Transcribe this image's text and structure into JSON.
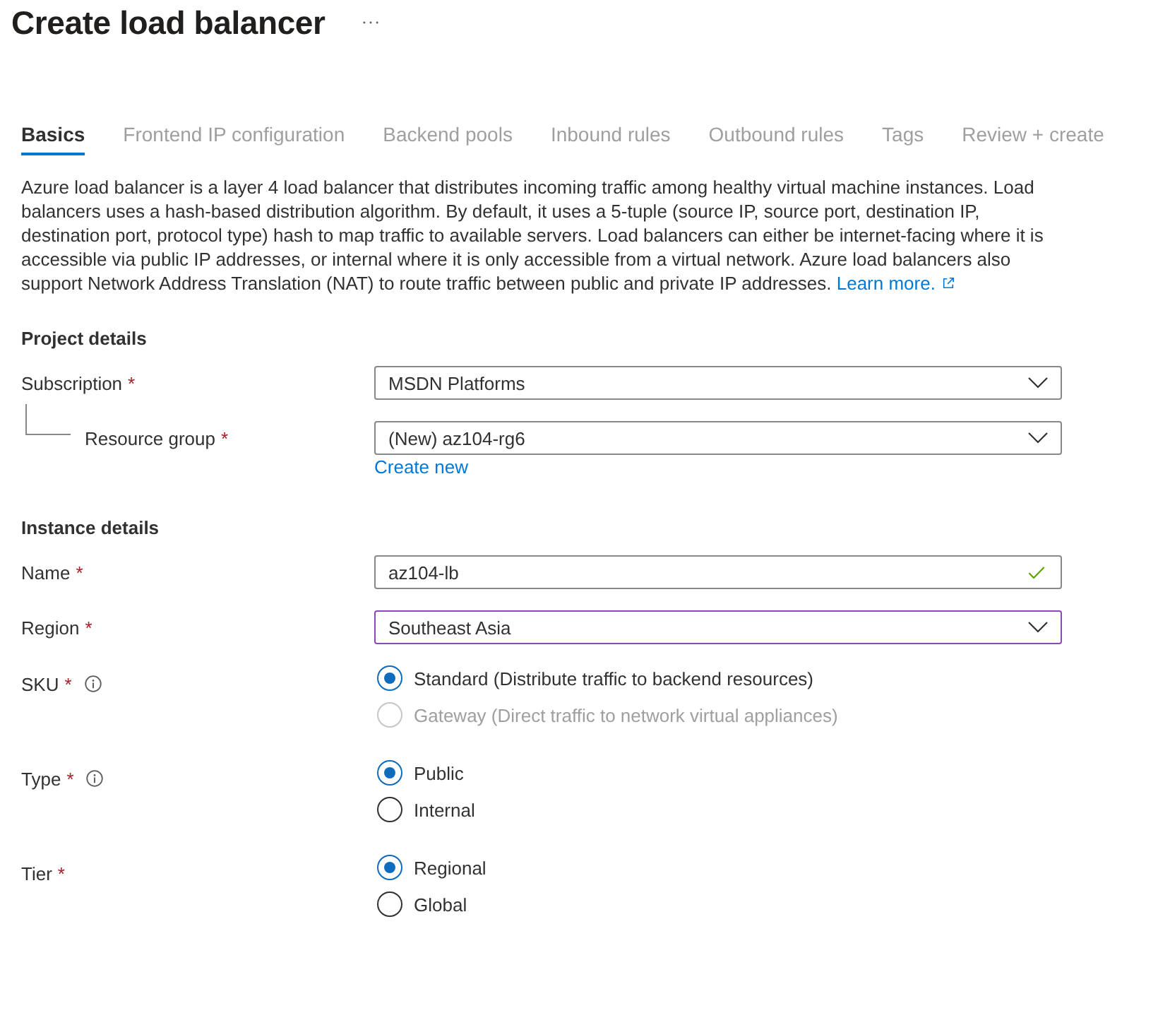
{
  "title": "Create load balancer",
  "tabs": [
    {
      "label": "Basics",
      "selected": true,
      "disabled": false
    },
    {
      "label": "Frontend IP configuration",
      "selected": false,
      "disabled": true
    },
    {
      "label": "Backend pools",
      "selected": false,
      "disabled": true
    },
    {
      "label": "Inbound rules",
      "selected": false,
      "disabled": true
    },
    {
      "label": "Outbound rules",
      "selected": false,
      "disabled": true
    },
    {
      "label": "Tags",
      "selected": false,
      "disabled": true
    },
    {
      "label": "Review + create",
      "selected": false,
      "disabled": true
    }
  ],
  "description": {
    "text": "Azure load balancer is a layer 4 load balancer that distributes incoming traffic among healthy virtual machine instances. Load balancers uses a hash-based distribution algorithm. By default, it uses a 5-tuple (source IP, source port, destination IP, destination port, protocol type) hash to map traffic to available servers. Load balancers can either be internet-facing where it is accessible via public IP addresses, or internal where it is only accessible from a virtual network. Azure load balancers also support Network Address Translation (NAT) to route traffic between public and private IP addresses.",
    "link": "Learn more."
  },
  "sections": [
    {
      "heading": "Project details",
      "fields": [
        {
          "kind": "dropdown",
          "label": "Subscription",
          "required_mark": "*",
          "value": "MSDN Platforms",
          "focused": false,
          "children": [
            {
              "kind": "dropdown",
              "label": "Resource group",
              "required_mark": "*",
              "value": "(New) az104-rg6",
              "focused": false,
              "link": "Create new"
            }
          ]
        }
      ]
    },
    {
      "heading": "Instance details",
      "fields": [
        {
          "kind": "text",
          "label": "Name",
          "required_mark": "*",
          "value": "az104-lb",
          "valid": true
        },
        {
          "kind": "dropdown",
          "label": "Region",
          "required_mark": "*",
          "value": "Southeast Asia",
          "focused": true
        },
        {
          "kind": "radio",
          "label": "SKU",
          "required_mark": "*",
          "info": true,
          "options": [
            {
              "label": "Standard (Distribute traffic to backend resources)",
              "selected": true,
              "disabled": false
            },
            {
              "label": "Gateway (Direct traffic to network virtual appliances)",
              "selected": false,
              "disabled": true
            }
          ]
        },
        {
          "kind": "radio",
          "label": "Type",
          "required_mark": "*",
          "info": true,
          "options": [
            {
              "label": "Public",
              "selected": true,
              "disabled": false
            },
            {
              "label": "Internal",
              "selected": false,
              "disabled": false
            }
          ]
        },
        {
          "kind": "radio",
          "label": "Tier",
          "required_mark": "*",
          "options": [
            {
              "label": "Regional",
              "selected": true,
              "disabled": false
            },
            {
              "label": "Global",
              "selected": false,
              "disabled": false
            }
          ]
        }
      ]
    }
  ]
}
